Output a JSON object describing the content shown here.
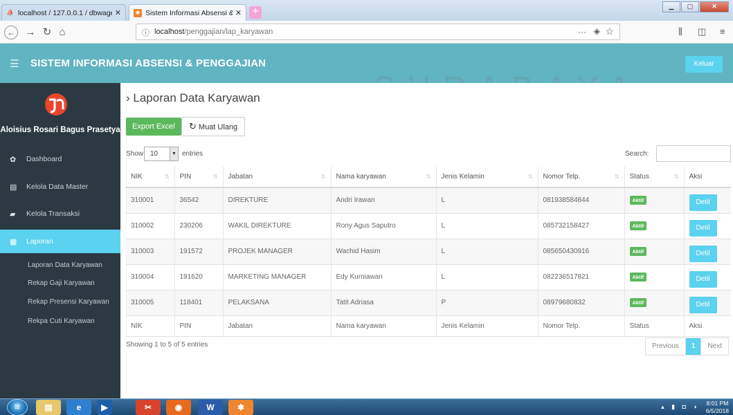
{
  "browser": {
    "tabs": [
      {
        "title": "localhost / 127.0.0.1 / dbwage",
        "close": "✕"
      },
      {
        "title": "Sistem Informasi Absensi & Pe",
        "close": "✕"
      }
    ],
    "new_tab": "+",
    "url_host": "localhost",
    "url_path": "/penggajian/lap_karyawan",
    "more_label": "···"
  },
  "header": {
    "title": "SISTEM INFORMASI ABSENSI & PENGGAJIAN",
    "logout_label": "Keluar"
  },
  "sidebar": {
    "user_name": "Aloisius Rosari Bagus Prasetya",
    "items": [
      {
        "label": "Dashboard",
        "icon": "dashboard-icon"
      },
      {
        "label": "Kelola Data Master",
        "icon": "master-data-icon"
      },
      {
        "label": "Kelola Transaksi",
        "icon": "transaction-icon"
      },
      {
        "label": "Laporan",
        "icon": "report-icon"
      }
    ],
    "sub_items": [
      {
        "label": "Laporan Data Karyawan"
      },
      {
        "label": "Rekap Gaji Karyawan"
      },
      {
        "label": "Rekap Presensi Karyawan"
      },
      {
        "label": "Rekpa Cuti Karyawan"
      }
    ]
  },
  "main": {
    "title": "Laporan Data Karyawan",
    "export_label": "Export Excel",
    "reload_label": "Muat Ulang",
    "show_label": "Show",
    "page_length": "10",
    "entries_label": "entries",
    "search_label": "Search:",
    "search_value": "",
    "columns": [
      "NIK",
      "PIN",
      "Jabatan",
      "Nama karyawan",
      "Jenis Kelamin",
      "Nomor Telp.",
      "Status",
      "Aksi"
    ],
    "rows": [
      {
        "nik": "310001",
        "pin": "36542",
        "jabatan": "DIREKTURE",
        "nama": "Andri Irawan",
        "jk": "L",
        "telp": "081938584844",
        "status": "Aktif",
        "aksi": "Detil"
      },
      {
        "nik": "310002",
        "pin": "230206",
        "jabatan": "WAKIL DIREKTURE",
        "nama": "Rony Agus Saputro",
        "jk": "L",
        "telp": "085732158427",
        "status": "Aktif",
        "aksi": "Detil"
      },
      {
        "nik": "310003",
        "pin": "191572",
        "jabatan": "PROJEK MANAGER",
        "nama": "Wachid Hasim",
        "jk": "L",
        "telp": "085650430916",
        "status": "Aktif",
        "aksi": "Detil"
      },
      {
        "nik": "310004",
        "pin": "191620",
        "jabatan": "MARKETING MANAGER",
        "nama": "Edy Kurniawan",
        "jk": "L",
        "telp": "082236517821",
        "status": "Aktif",
        "aksi": "Detil"
      },
      {
        "nik": "310005",
        "pin": "118401",
        "jabatan": "PELAKSANA",
        "nama": "Tatit Adriasa",
        "jk": "P",
        "telp": "08979680832",
        "status": "Aktif",
        "aksi": "Detil"
      }
    ],
    "info": "Showing 1 to 5 of 5 entries",
    "pagination": {
      "prev": "Previous",
      "current": "1",
      "next": "Next"
    }
  },
  "watermark": "SURABAYA",
  "taskbar": {
    "time": "8:01 PM",
    "date": "6/5/2018"
  },
  "colors": {
    "header": "#61b4c2",
    "sidebar": "#2b3a42",
    "accent": "#5bd2ef",
    "success": "#5cb85c"
  }
}
